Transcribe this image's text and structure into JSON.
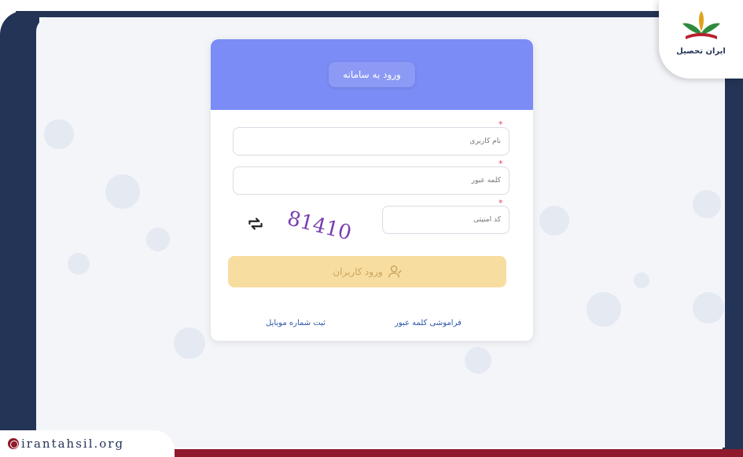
{
  "header": {
    "title": "ورود به سامانه"
  },
  "form": {
    "username_placeholder": "نام کاربری",
    "password_placeholder": "کلمه عبور",
    "captcha_placeholder": "کد امنیتی",
    "captcha_text": "81410",
    "login_label": "ورود کاربران",
    "forgot_password_label": "فراموشی کلمه عبور",
    "register_mobile_label": "ثبت شماره موبایل"
  },
  "brand": {
    "name": "ایران تحصیل",
    "site": "irantahsil.org"
  },
  "colors": {
    "header": "#7b8cf6",
    "button": "#f8dda0",
    "link": "#2c56a8",
    "frame": "#243456",
    "accent": "#8e1a2b"
  },
  "icons": {
    "refresh": "refresh-icon",
    "user": "user-icon",
    "globe": "globe-icon"
  }
}
